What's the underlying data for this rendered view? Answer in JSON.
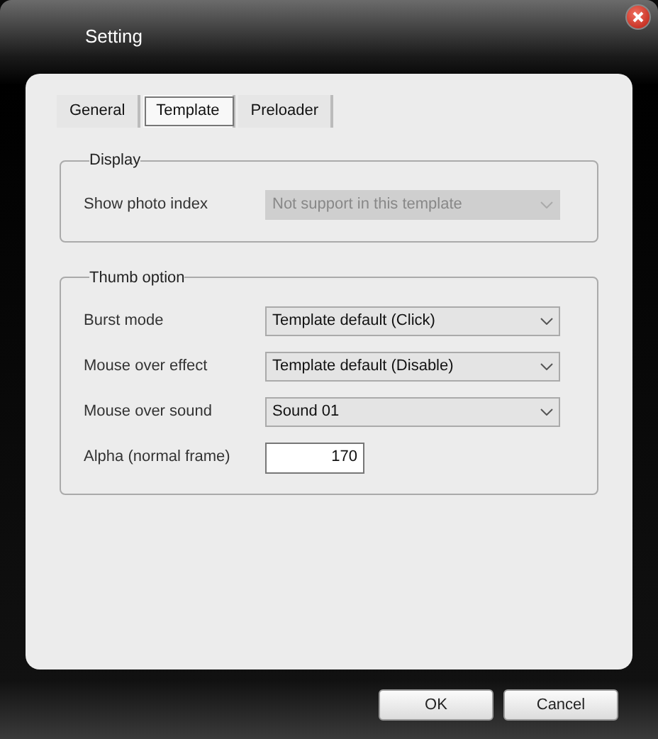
{
  "window": {
    "title": "Setting"
  },
  "tabs": [
    {
      "label": "General",
      "selected": false
    },
    {
      "label": "Template",
      "selected": true
    },
    {
      "label": "Preloader",
      "selected": false
    }
  ],
  "groups": [
    {
      "title": "Display",
      "rows": [
        {
          "label": "Show photo index",
          "kind": "dropdown",
          "value": "Not support in this template",
          "disabled": true
        }
      ]
    },
    {
      "title": "Thumb option",
      "rows": [
        {
          "label": "Burst mode",
          "kind": "dropdown",
          "value": "Template default (Click)",
          "disabled": false
        },
        {
          "label": "Mouse over effect",
          "kind": "dropdown",
          "value": "Template default (Disable)",
          "disabled": false
        },
        {
          "label": "Mouse over sound",
          "kind": "dropdown",
          "value": "Sound 01",
          "disabled": false
        },
        {
          "label": "Alpha (normal frame)",
          "kind": "number",
          "value": "170",
          "disabled": false
        }
      ]
    }
  ],
  "buttons": [
    "OK",
    "Cancel"
  ]
}
